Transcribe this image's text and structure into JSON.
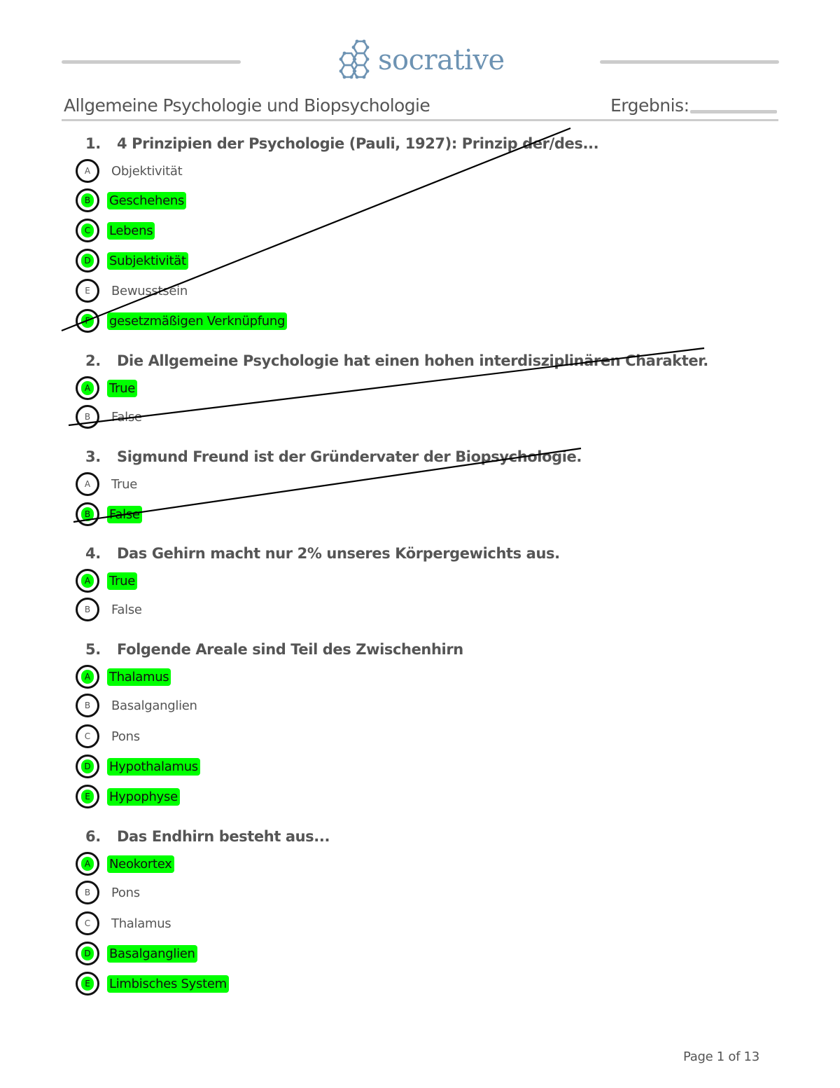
{
  "header": {
    "brand": "socrative",
    "brand_color": "#6d93b3",
    "logo_icon": "hexagon-molecule-icon",
    "title": "Allgemeine Psychologie und Biopsychologie",
    "score_label": "Ergebnis:"
  },
  "highlight_color": "#00ff00",
  "questions": [
    {
      "number": "1.",
      "text": "4 Prinzipien der Psychologie (Pauli, 1927): Prinzip der/des...",
      "struck_through": true,
      "options": [
        {
          "letter": "A",
          "text": "Objektivität",
          "correct": false
        },
        {
          "letter": "B",
          "text": "Geschehens",
          "correct": true
        },
        {
          "letter": "C",
          "text": "Lebens",
          "correct": true
        },
        {
          "letter": "D",
          "text": "Subjektivität",
          "correct": true
        },
        {
          "letter": "E",
          "text": "Bewusstsein",
          "correct": false
        },
        {
          "letter": "F",
          "text": "gesetzmäßigen Verknüpfung",
          "correct": true
        }
      ]
    },
    {
      "number": "2.",
      "text": "Die Allgemeine Psychologie hat einen hohen interdisziplinären Charakter.",
      "struck_through": true,
      "options": [
        {
          "letter": "A",
          "text": "True",
          "correct": true
        },
        {
          "letter": "B",
          "text": "False",
          "correct": false
        }
      ]
    },
    {
      "number": "3.",
      "text": "Sigmund Freund ist der Gründervater der Biopsychologie.",
      "struck_through": true,
      "options": [
        {
          "letter": "A",
          "text": "True",
          "correct": false
        },
        {
          "letter": "B",
          "text": "False",
          "correct": true
        }
      ]
    },
    {
      "number": "4.",
      "text": "Das Gehirn macht nur 2% unseres Körpergewichts aus.",
      "struck_through": false,
      "options": [
        {
          "letter": "A",
          "text": "True",
          "correct": true
        },
        {
          "letter": "B",
          "text": "False",
          "correct": false
        }
      ]
    },
    {
      "number": "5.",
      "text": "Folgende Areale sind Teil des Zwischenhirn",
      "struck_through": false,
      "options": [
        {
          "letter": "A",
          "text": "Thalamus",
          "correct": true
        },
        {
          "letter": "B",
          "text": "Basalganglien",
          "correct": false
        },
        {
          "letter": "C",
          "text": "Pons",
          "correct": false
        },
        {
          "letter": "D",
          "text": "Hypothalamus",
          "correct": true
        },
        {
          "letter": "E",
          "text": "Hypophyse",
          "correct": true
        }
      ]
    },
    {
      "number": "6.",
      "text": "Das Endhirn besteht aus...",
      "struck_through": false,
      "options": [
        {
          "letter": "A",
          "text": "Neokortex",
          "correct": true
        },
        {
          "letter": "B",
          "text": "Pons",
          "correct": false
        },
        {
          "letter": "C",
          "text": "Thalamus",
          "correct": false
        },
        {
          "letter": "D",
          "text": "Basalganglien",
          "correct": true
        },
        {
          "letter": "E",
          "text": "Limbisches System",
          "correct": true
        }
      ]
    }
  ],
  "footer": {
    "page_label": "Page 1 of 13"
  }
}
